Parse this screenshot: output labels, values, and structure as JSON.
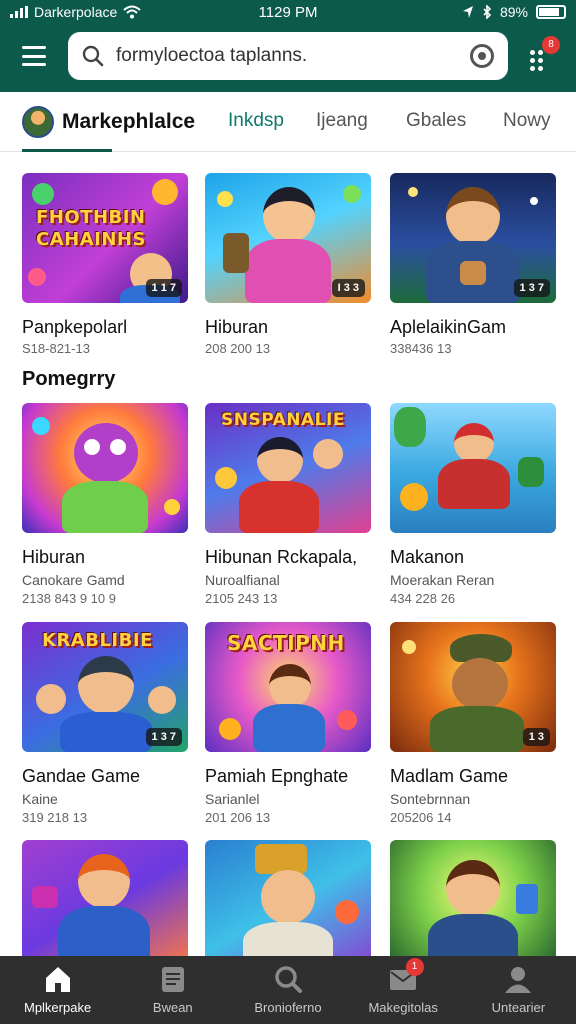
{
  "status_bar": {
    "carrier": "Darkerpolace",
    "time": "1129 PM",
    "battery": "89%"
  },
  "search": {
    "value": "formyloectoa taplanns."
  },
  "app_bar": {
    "badge": "8"
  },
  "tabs": {
    "brand": "Markephlalce",
    "items": [
      {
        "label": "Inkdsp",
        "active": true
      },
      {
        "label": "Ijeang",
        "active": false
      },
      {
        "label": "Gbales",
        "active": false
      },
      {
        "label": "Nowy",
        "active": false
      }
    ]
  },
  "row1": [
    {
      "title": "Panpkepolarl",
      "meta": "S18-821-13",
      "count": "1 1 7",
      "thumb_text": "FHOTHBIN CAHAINHS"
    },
    {
      "title": "Hiburan",
      "meta": "208 200 13",
      "count": "I 3 3"
    },
    {
      "title": "AplelaikinGam",
      "meta": "338436 13",
      "count": "1 3 7"
    }
  ],
  "section": {
    "title": "Pomegrry"
  },
  "row2": [
    {
      "title": "Hiburan",
      "sub": "Canokare Gamd",
      "meta": "2138 843 9 10 9"
    },
    {
      "title": "Hibunan Rckapala,",
      "sub": "Nuroalfianal",
      "meta": "2105 243 13",
      "thumb_text": "SNSPANALIE"
    },
    {
      "title": "Makanon",
      "sub": "Moerakan Reran",
      "meta": "434 228 26"
    }
  ],
  "row3": [
    {
      "title": "Gandae Game",
      "sub": "Kaine",
      "meta": "319 218 13",
      "count": "1 3 7",
      "thumb_text": "KRABLIBIE"
    },
    {
      "title": "Pamiah Epnghate",
      "sub": "Sarianlel",
      "meta": "201 206 13",
      "thumb_text": "SACTIPNH"
    },
    {
      "title": "Madlam Game",
      "sub": "Sontebrnnan",
      "meta": "205206 14",
      "count": "1 3"
    }
  ],
  "bottom_nav": [
    {
      "label": "Mplkerpake",
      "icon": "home-icon",
      "active": true
    },
    {
      "label": "Bwean",
      "icon": "document-icon",
      "active": false
    },
    {
      "label": "Bronioferno",
      "icon": "search-icon",
      "active": false
    },
    {
      "label": "Makegitolas",
      "icon": "mail-icon",
      "active": false,
      "badge": "1"
    },
    {
      "label": "Untearier",
      "icon": "profile-icon",
      "active": false
    }
  ],
  "colors": {
    "brand_teal": "#0c5a4c",
    "accent_teal": "#0e7a6a",
    "badge_red": "#e53935",
    "nav_background": "#2f2f2f"
  }
}
